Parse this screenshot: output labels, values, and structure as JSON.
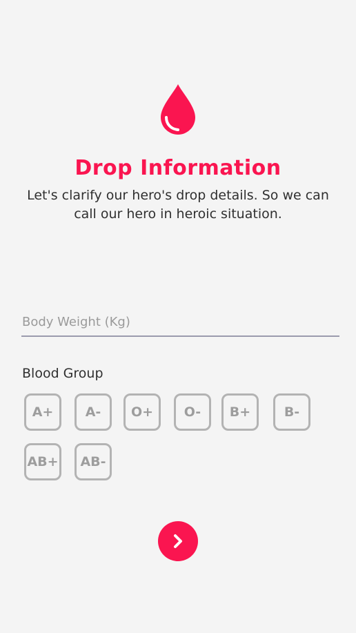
{
  "header": {
    "title": "Drop Information",
    "subtitle": "Let's clarify our hero's drop details. So we can call our hero in heroic situation."
  },
  "form": {
    "weight_placeholder": "Body Weight (Kg)",
    "weight_value": "",
    "blood_group_label": "Blood Group",
    "blood_groups": [
      "A+",
      "A-",
      "O+",
      "O-",
      "B+",
      "B-",
      "AB+",
      "AB-"
    ]
  },
  "icons": {
    "drop": "blood-drop-icon",
    "next": "chevron-right-icon"
  },
  "colors": {
    "accent": "#fa1550",
    "option_border": "#b3b3b3",
    "option_text": "#9d9d9d",
    "background": "#f4f4f4"
  }
}
